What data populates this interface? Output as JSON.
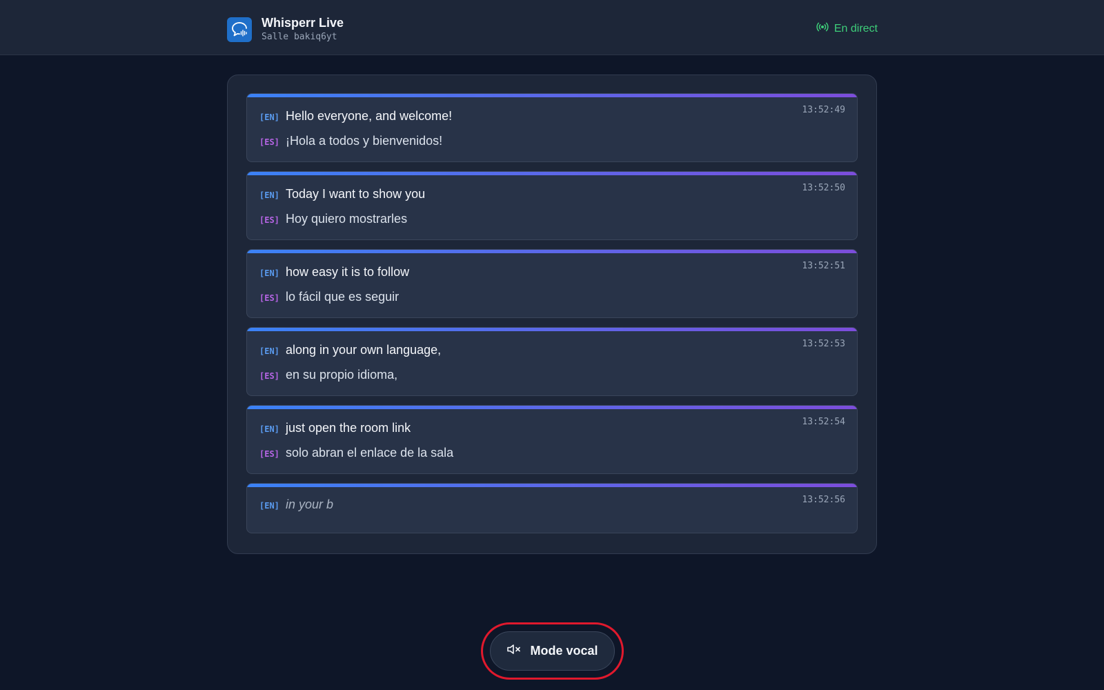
{
  "header": {
    "app_title": "Whisperr Live",
    "room_label": "Salle bakiq6yt",
    "status_label": "En direct",
    "status_color": "#3ecf7a",
    "logo_icon": "chat-bubble-waveform-icon",
    "status_icon": "broadcast-icon"
  },
  "transcript": {
    "entries": [
      {
        "time": "13:52:49",
        "en_tag": "[EN]",
        "en": "Hello everyone, and welcome!",
        "es_tag": "[ES]",
        "es": "¡Hola a todos y bienvenidos!"
      },
      {
        "time": "13:52:50",
        "en_tag": "[EN]",
        "en": "Today I want to show you",
        "es_tag": "[ES]",
        "es": "Hoy quiero mostrarles"
      },
      {
        "time": "13:52:51",
        "en_tag": "[EN]",
        "en": "how easy it is to follow",
        "es_tag": "[ES]",
        "es": "lo fácil que es seguir"
      },
      {
        "time": "13:52:53",
        "en_tag": "[EN]",
        "en": "along in your own language,",
        "es_tag": "[ES]",
        "es": "en su propio idioma,"
      },
      {
        "time": "13:52:54",
        "en_tag": "[EN]",
        "en": "just open the room link",
        "es_tag": "[ES]",
        "es": "solo abran el enlace de la sala"
      }
    ],
    "pending": {
      "time": "13:52:56",
      "en_tag": "[EN]",
      "en": "in your b"
    }
  },
  "voice_mode": {
    "label": "Mode vocal",
    "icon": "speaker-muted-icon"
  },
  "colors": {
    "background": "#0e1628",
    "panel": "#1d2638",
    "en_tag": "#5a9bf0",
    "es_tag": "#b765e6",
    "highlight_ring": "#e0192d"
  }
}
